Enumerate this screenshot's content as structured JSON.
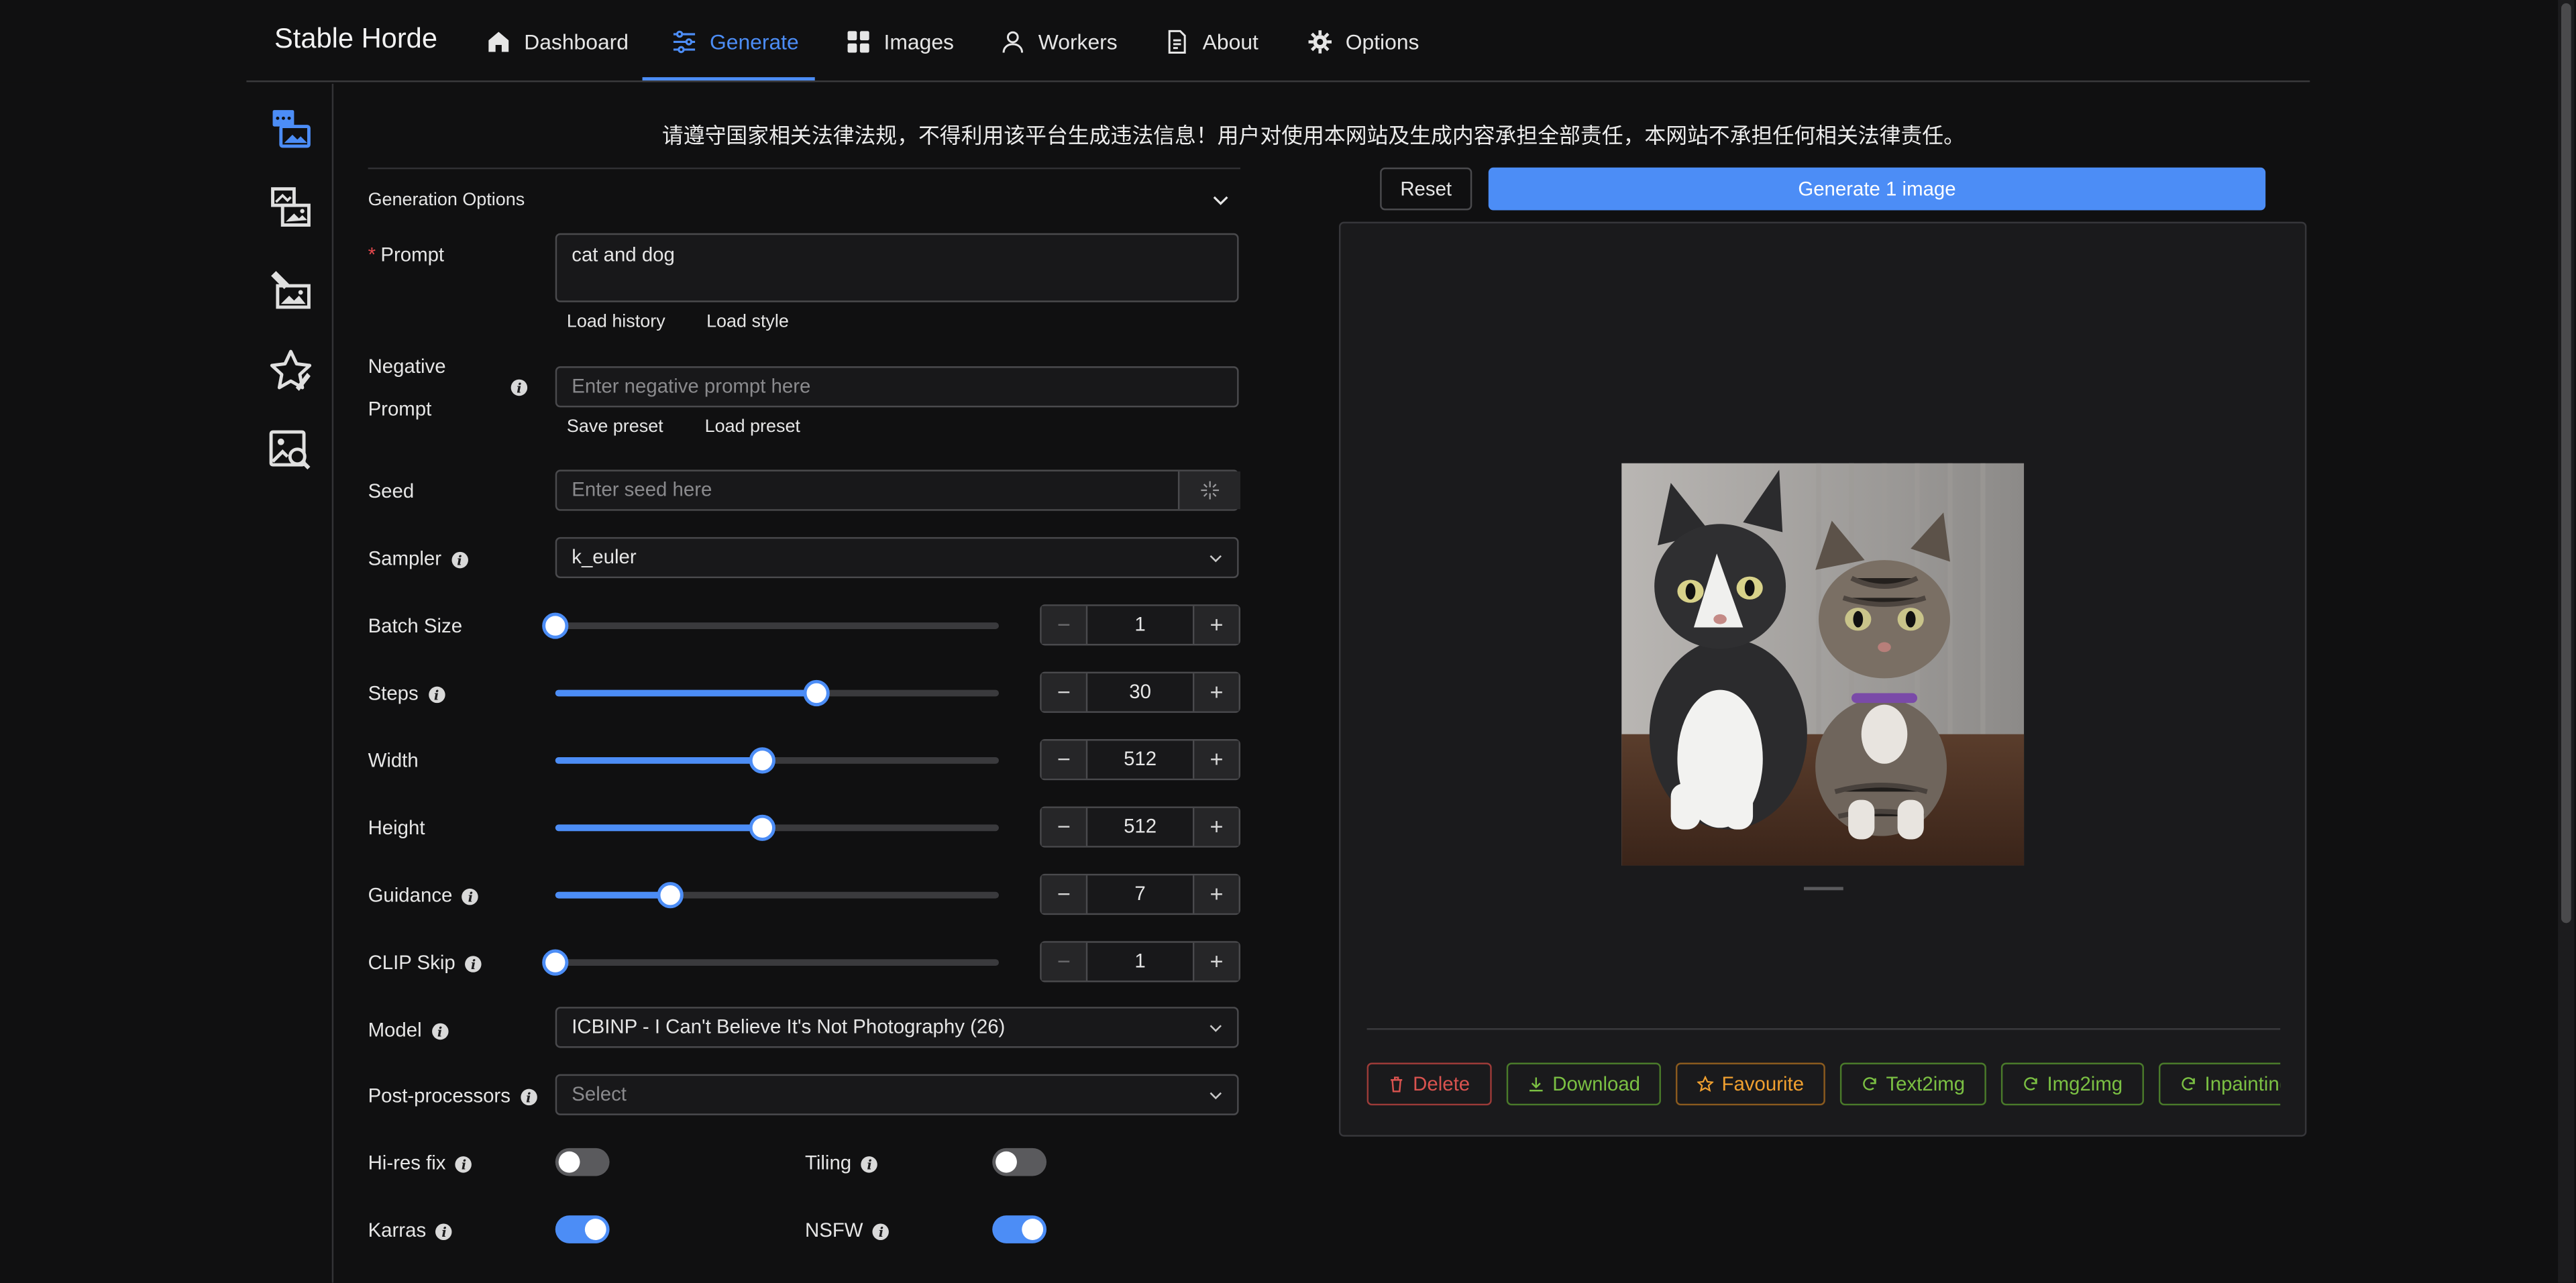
{
  "header": {
    "brand": "Stable Horde",
    "nav": [
      {
        "label": "Dashboard",
        "icon": "home-icon"
      },
      {
        "label": "Generate",
        "icon": "sliders-icon",
        "active": true
      },
      {
        "label": "Images",
        "icon": "grid-icon"
      },
      {
        "label": "Workers",
        "icon": "user-icon"
      },
      {
        "label": "About",
        "icon": "document-icon"
      },
      {
        "label": "Options",
        "icon": "gear-icon"
      }
    ]
  },
  "sidebar": {
    "items": [
      "text2img-icon",
      "img2img-icon",
      "inpainting-icon",
      "rating-icon",
      "image-search-icon"
    ]
  },
  "notice": "请遵守国家相关法律法规，不得利用该平台生成违法信息！用户对使用本网站及生成内容承担全部责任，本网站不承担任何相关法律责任。",
  "form": {
    "section_title": "Generation Options",
    "prompt": {
      "label": "Prompt",
      "value": "cat and dog",
      "links": [
        "Load history",
        "Load style"
      ]
    },
    "negative_prompt": {
      "label_line1": "Negative",
      "label_line2": "Prompt",
      "placeholder": "Enter negative prompt here",
      "links": [
        "Save preset",
        "Load preset"
      ]
    },
    "seed": {
      "label": "Seed",
      "placeholder": "Enter seed here"
    },
    "sampler": {
      "label": "Sampler",
      "value": "k_euler"
    },
    "batch_size": {
      "label": "Batch Size",
      "value": "1",
      "fraction": 0.0
    },
    "steps": {
      "label": "Steps",
      "value": "30",
      "fraction": 0.59
    },
    "width": {
      "label": "Width",
      "value": "512",
      "fraction": 0.467
    },
    "height": {
      "label": "Height",
      "value": "512",
      "fraction": 0.467
    },
    "guidance": {
      "label": "Guidance",
      "value": "7",
      "fraction": 0.26
    },
    "clip_skip": {
      "label": "CLIP Skip",
      "value": "1",
      "fraction": 0.0
    },
    "model": {
      "label": "Model",
      "value": "ICBINP - I Can't Believe It's Not Photography (26)"
    },
    "post_processors": {
      "label": "Post-processors",
      "placeholder": "Select"
    },
    "hires_fix": {
      "label": "Hi-res fix",
      "on": false
    },
    "tiling": {
      "label": "Tiling",
      "on": false
    },
    "karras": {
      "label": "Karras",
      "on": true
    },
    "nsfw": {
      "label": "NSFW",
      "on": true
    }
  },
  "actions": {
    "reset": "Reset",
    "generate": "Generate 1 image"
  },
  "result": {
    "buttons": [
      {
        "label": "Delete",
        "color": "#d9534f",
        "icon": "trash-icon"
      },
      {
        "label": "Download",
        "color": "#6aa84f",
        "icon": "download-icon"
      },
      {
        "label": "Favourite",
        "color": "#e69138",
        "icon": "star-icon"
      },
      {
        "label": "Text2img",
        "color": "#6aa84f",
        "icon": "refresh-icon"
      },
      {
        "label": "Img2img",
        "color": "#6aa84f",
        "icon": "refresh-icon"
      },
      {
        "label": "Inpainting",
        "color": "#6aa84f",
        "icon": "refresh-icon"
      }
    ]
  },
  "colors": {
    "accent": "#4c8df6",
    "background": "#101011"
  }
}
